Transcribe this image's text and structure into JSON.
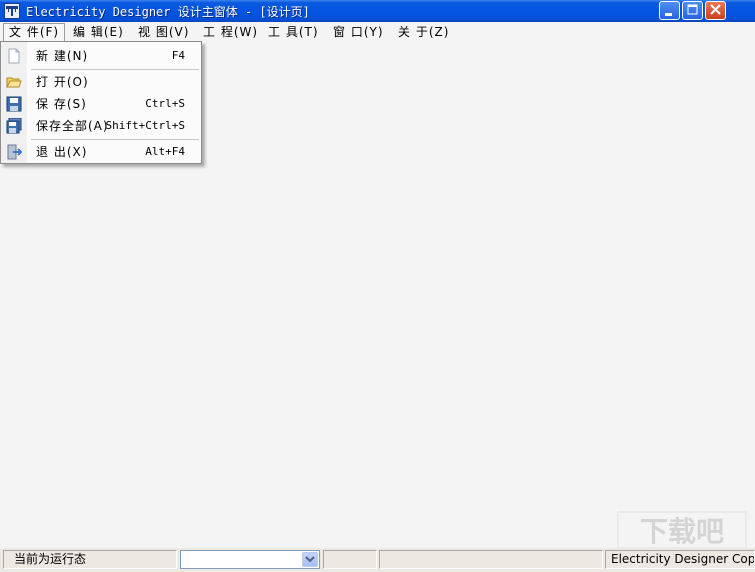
{
  "window": {
    "title": "Electricity Designer 设计主窗体 - [设计页]",
    "icon": "app-icon",
    "controls": [
      "minimize-icon",
      "maximize-icon",
      "close-icon"
    ]
  },
  "menubar": {
    "items": [
      {
        "label": "文 件(F)",
        "active": true
      },
      {
        "label": "编 辑(E)"
      },
      {
        "label": "视 图(V)"
      },
      {
        "label": "工 程(W)"
      },
      {
        "label": "工 具(T)"
      },
      {
        "label": "窗 口(Y)"
      },
      {
        "label": "关 于(Z)"
      }
    ]
  },
  "file_menu": {
    "items": [
      {
        "label": "新 建(N)",
        "shortcut": "F4",
        "icon": "new-file-icon"
      },
      {
        "label": "打 开(O)",
        "shortcut": "",
        "icon": "open-folder-icon"
      },
      {
        "label": "保 存(S)",
        "shortcut": "Ctrl+S",
        "icon": "save-icon"
      },
      {
        "label": "保存全部(A)",
        "shortcut": "Shift+Ctrl+S",
        "icon": "save-all-icon"
      },
      {
        "label": "退 出(X)",
        "shortcut": "Alt+F4",
        "icon": "exit-icon"
      }
    ]
  },
  "statusbar": {
    "state_text": "当前为运行态",
    "combo_value": "",
    "panel3": "",
    "panel4": "",
    "copyright": "Electricity Designer CopyRight"
  },
  "watermark": "下载吧"
}
